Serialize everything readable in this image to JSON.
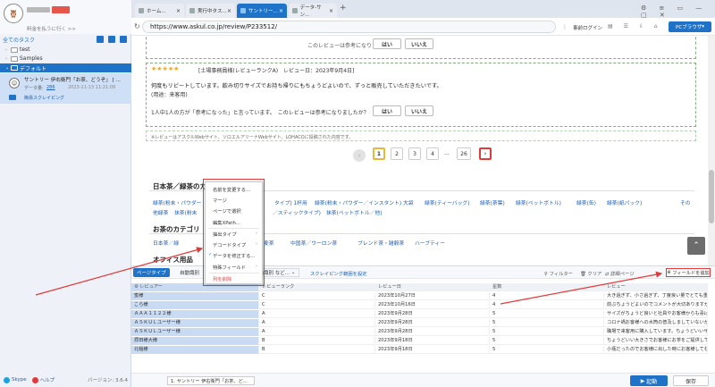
{
  "sidebar": {
    "brand_caption": "料金を払うに行く >>",
    "all_tasks": "全てのタスク",
    "tree": [
      {
        "label": "test"
      },
      {
        "label": "Samples"
      },
      {
        "label": "デフォルト"
      }
    ],
    "task": {
      "title": "サントリー 伊右衛門「お茶、どうぞ」 [ ...",
      "meta_label": "データ量:",
      "meta_count": "286",
      "date": "2023-11-13 11:21:09",
      "mode": "簡易スクレイピング"
    },
    "footer": {
      "skype": "Skype",
      "help": "ヘルプ",
      "version": "バージョン: 3.6.4"
    }
  },
  "tabs": [
    {
      "label": "ホーム..."
    },
    {
      "label": "実行中タス..."
    },
    {
      "label": "サントリー..."
    },
    {
      "label": "データ-サン..."
    }
  ],
  "address": {
    "url": "https://www.askul.co.jp/review/P233512/",
    "login": "事前ログイン",
    "pc_browser": "PCブラウザ"
  },
  "review": {
    "partial_question": "このレビューは参考になりましたか？",
    "stars": "★★★★★",
    "reviewer_line": "[土場事務員様(レビューランクA)　レビュー日：2023年9月4日]",
    "body1": "何度もリピートしています。飲み切りサイズでお持ち帰りにもちょうどよいので、ずっと販売していただきたいです。",
    "body2": "(用途：来客用)",
    "helpful": "1人中1人の方が「参考になった」と言っています。　このレビューは参考になりましたか？",
    "yes": "はい",
    "no": "いいえ",
    "note": "※レビューはアスクルWebサイト、ソロエルアリーナWebサイト、LOHACOに投稿された内容です。"
  },
  "pagination": [
    "1",
    "2",
    "3",
    "4",
    "...",
    "26"
  ],
  "sections": {
    "green_tea_title": "日本茶／緑茶のカ",
    "green_tea_row1": [
      "緑茶(粉末・パウダー",
      "タイプ) 1杯用",
      "緑茶(粉末・パウダー／インスタント) 大袋",
      "緑茶(ティーバッグ)",
      "緑茶(茶葉)",
      "緑茶(ペットボトル)",
      "緑茶(缶)",
      "緑茶(紙パック)",
      "その"
    ],
    "green_tea_row2": [
      "他緑茶",
      "抹茶(粉末",
      "／スティックタイプ)",
      "抹茶(ペットボトル／他)"
    ],
    "category_title": "お茶のカテゴリ",
    "category_row": [
      "日本茶／緑",
      "麦茶",
      "中国茶／ウーロン茶",
      "ブレンド茶・雑穀茶",
      "ハーブティー"
    ],
    "office_title": "オフィス用品"
  },
  "context_menu": {
    "items": [
      "名前を変更する...",
      "マージ",
      "ページで選択",
      "編集XPath...",
      "抽出タイプ",
      "デコードタイプ",
      "データを修正する...",
      "特殊フィールド",
      "列を削除"
    ]
  },
  "panel": {
    "tab_page": "ページタイプ",
    "tab_auto": "自動識別",
    "tab_auto2": "自動識別 など...",
    "scrape_link": "スクレイピング範囲を設定",
    "filter": "フィルター",
    "clear": "クリア",
    "detail": "詳細ページ",
    "add_field": "フィールドを追加",
    "columns": [
      "レビュアー",
      "レビューランク",
      "レビュー日",
      "星数",
      "レビュー"
    ],
    "rows": [
      [
        "蜜様",
        "C",
        "2023年10月27日",
        "4",
        "大き過ぎず、小さ過ぎず、丁度良い量でとても重宝し"
      ],
      [
        "こら様",
        "C",
        "2023年10月16日",
        "4",
        "前ぶちょうどよいのでコメントが大切ありますが、"
      ],
      [
        "ＡＡＡ１１２２様",
        "A",
        "2023年9月28日",
        "5",
        "サイズがちょうど良いと社員やお客様からも喜ばれ"
      ],
      [
        "ＡＳＫＵＬユーザー様",
        "A",
        "2023年9月28日",
        "5",
        "コロナ禍お客様への水筒の普及しましていないかたに"
      ],
      [
        "ＡＳＫＵＬユーザー様",
        "A",
        "2023年9月28日",
        "5",
        "職場で来客用に購入しています。ちょうどいいサイズ"
      ],
      [
        "拝田様大様",
        "B",
        "2023年9月18日",
        "5",
        "ちょうどいい大きさでお客様にお茶をご提供しています"
      ],
      [
        "北稲様",
        "B",
        "2023年9月18日",
        "5",
        "小瓶だったのでお客様に出した時にお客様しても飲み"
      ]
    ]
  },
  "footer": {
    "task_chip": "1. サントリー 伊右衛門「お茶、ど...",
    "start": "起動",
    "save": "保存"
  }
}
